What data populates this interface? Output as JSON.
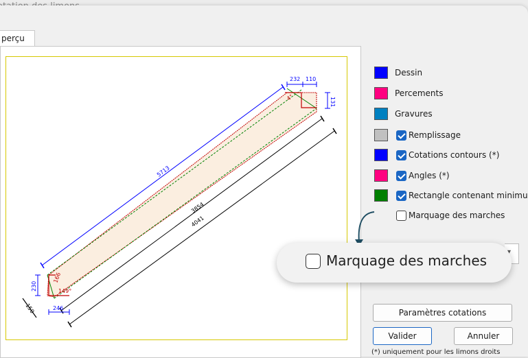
{
  "window": {
    "title": "otation des limons"
  },
  "tabs": [
    {
      "label": "perçu"
    }
  ],
  "drawing": {
    "dims": {
      "top_left": "232",
      "top_right": "110",
      "right_end": "131",
      "long_blue": "5713",
      "middle": "3854",
      "long_black": "4041",
      "left_height": "230",
      "left_diag": "150",
      "bottom": "246",
      "angle_bottom": "149°",
      "angle_left": "166",
      "angle_top": "4°"
    },
    "colors": {
      "body_fill": "#fbeee0",
      "outline": "#c00000",
      "blue": "#0000ff",
      "green": "#008000",
      "black": "#000000"
    }
  },
  "legend": [
    {
      "label": "Dessin",
      "color": "#0000ff",
      "has_checkbox": false
    },
    {
      "label": "Percements",
      "color": "#ff0080",
      "has_checkbox": false
    },
    {
      "label": "Gravures",
      "color": "#0080c0",
      "has_checkbox": false
    },
    {
      "label": "Remplissage",
      "color": "#c0c0c0",
      "has_checkbox": true,
      "checked": true
    },
    {
      "label": "Cotations contours (*)",
      "color": "#0000ff",
      "has_checkbox": true,
      "checked": true
    },
    {
      "label": "Angles (*)",
      "color": "#ff0080",
      "has_checkbox": true,
      "checked": true
    },
    {
      "label": "Rectangle contenant minimu",
      "color": "#008000",
      "has_checkbox": true,
      "checked": true
    },
    {
      "label": "Marquage des marches",
      "color": null,
      "has_checkbox": true,
      "checked": false
    }
  ],
  "callout": {
    "label": "Marquage des marches",
    "checked": false
  },
  "combo": {
    "arrow": "▾"
  },
  "buttons": {
    "params": "Paramètres cotations",
    "ok": "Valider",
    "cancel": "Annuler"
  },
  "footnote": "(*) uniquement pour les limons droits"
}
